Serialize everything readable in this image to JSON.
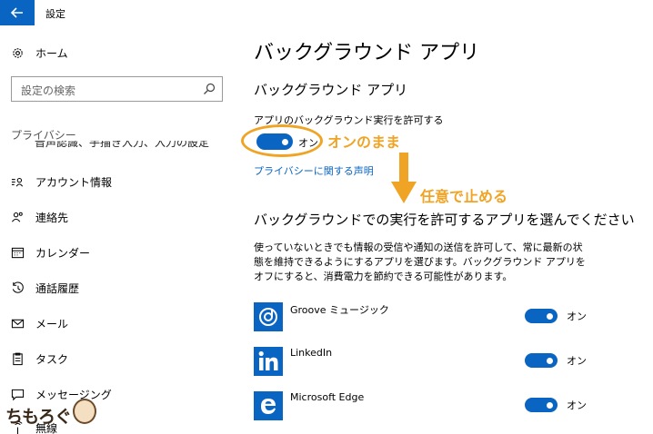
{
  "window": {
    "title": "設定"
  },
  "nav": {
    "home": "ホーム",
    "search_placeholder": "設定の検索",
    "section": "プライバシー",
    "cut_item": "音声認識、手描き入力、入力の設定",
    "items": [
      {
        "label": "アカウント情報",
        "icon": "account-info-icon"
      },
      {
        "label": "連絡先",
        "icon": "contacts-icon"
      },
      {
        "label": "カレンダー",
        "icon": "calendar-icon"
      },
      {
        "label": "通話履歴",
        "icon": "call-history-icon"
      },
      {
        "label": "メール",
        "icon": "mail-icon"
      },
      {
        "label": "タスク",
        "icon": "tasks-icon"
      },
      {
        "label": "メッセージング",
        "icon": "messaging-icon"
      },
      {
        "label": "無線",
        "icon": "radio-icon"
      }
    ]
  },
  "main": {
    "page_title": "バックグラウンド アプリ",
    "sub_title": "バックグラウンド アプリ",
    "toggle_label": "アプリのバックグラウンド実行を許可する",
    "toggle_state": "オン",
    "privacy_link": "プライバシーに関する声明",
    "section_title": "バックグラウンドでの実行を許可するアプリを選んでください",
    "description": "使っていないときでも情報の受信や通知の送信を許可して、常に最新の状態を維持できるようにするアプリを選びます。バックグラウンド アプリをオフにすると、消費電力を節約できる可能性があります。",
    "apps": [
      {
        "name": "Groove ミュージック",
        "state": "オン",
        "icon": "groove-music-icon"
      },
      {
        "name": "LinkedIn",
        "state": "オン",
        "icon": "linkedin-icon"
      },
      {
        "name": "Microsoft Edge",
        "state": "オン",
        "icon": "edge-icon"
      }
    ]
  },
  "annotations": {
    "keep_on": "オンのまま",
    "optional_stop": "任意で止める"
  },
  "watermark": {
    "text": "ちもろぐ"
  },
  "colors": {
    "accent": "#0a64c2",
    "annotation": "#f0a425"
  }
}
